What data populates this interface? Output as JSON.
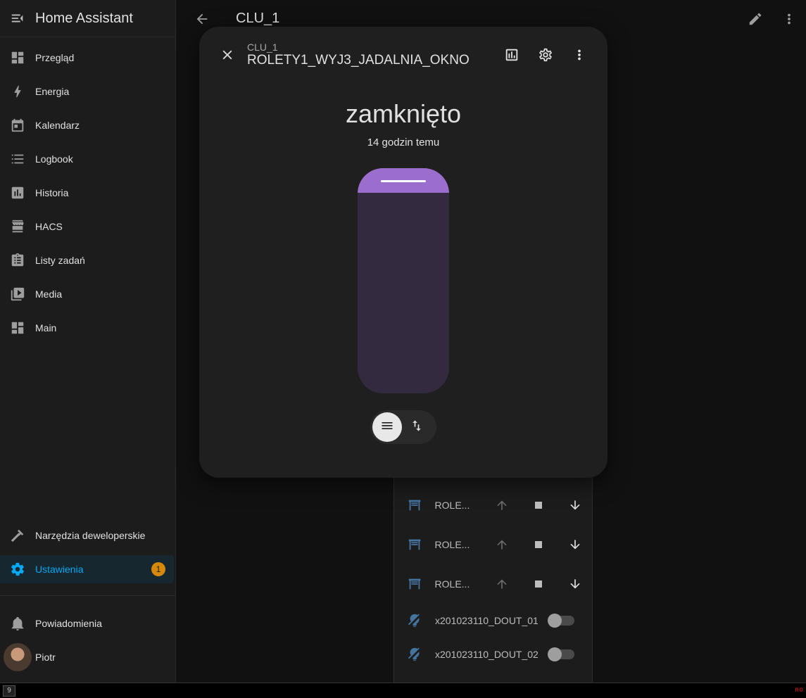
{
  "app": {
    "title": "Home Assistant"
  },
  "page": {
    "title": "CLU_1"
  },
  "sidebar": {
    "items": [
      {
        "label": "Przegląd",
        "icon": "dashboard-icon"
      },
      {
        "label": "Energia",
        "icon": "lightning-icon"
      },
      {
        "label": "Kalendarz",
        "icon": "calendar-icon"
      },
      {
        "label": "Logbook",
        "icon": "list-icon"
      },
      {
        "label": "Historia",
        "icon": "chart-box-icon"
      },
      {
        "label": "HACS",
        "icon": "hacs-icon"
      },
      {
        "label": "Listy zadań",
        "icon": "clipboard-list-icon"
      },
      {
        "label": "Media",
        "icon": "play-box-icon"
      },
      {
        "label": "Main",
        "icon": "dashboard-icon"
      }
    ],
    "developer": {
      "label": "Narzędzia deweloperskie"
    },
    "settings": {
      "label": "Ustawienia",
      "badge": "1"
    },
    "notifications": {
      "label": "Powiadomienia"
    },
    "user": {
      "label": "Piotr"
    }
  },
  "card": {
    "rows": [
      {
        "name": "ROLE..."
      },
      {
        "name": "ROLE..."
      },
      {
        "name": "ROLE..."
      }
    ],
    "switches": [
      {
        "name": "x201023110_DOUT_01",
        "on": false
      },
      {
        "name": "x201023110_DOUT_02",
        "on": false
      }
    ]
  },
  "dialog": {
    "subtitle": "CLU_1",
    "title": "ROLETY1_WYJ3_JADALNIA_OKNO",
    "state": "zamknięto",
    "last_changed": "14 godzin temu",
    "position_percent_closed": 89
  },
  "statusbar": {
    "left": "9",
    "right": "no"
  },
  "colors": {
    "accent": "#03a9f4",
    "slider": "#9b6ece",
    "badge": "#d4890a"
  }
}
